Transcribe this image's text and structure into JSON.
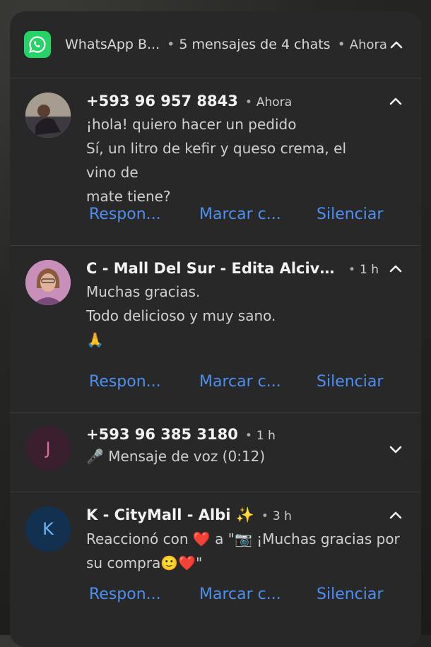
{
  "header": {
    "app_name": "WhatsApp B...",
    "summary": "5 mensajes de 4 chats",
    "time": "Ahora",
    "app_icon": "whatsapp-business-icon"
  },
  "notifications": [
    {
      "sender": "+593 96 957 8843",
      "time": "Ahora",
      "lines": [
        "¡hola! quiero hacer un pedido",
        "Sí, un litro de kefir y queso crema, el vino de",
        "mate tiene?"
      ],
      "expanded": true,
      "avatar": "photo"
    },
    {
      "sender": "C - Mall Del Sur - Edita Alcivar de...",
      "time": "1 h",
      "lines": [
        "Muchas gracias.",
        "Todo delicioso y muy sano.",
        "🙏"
      ],
      "expanded": true,
      "avatar": "photo"
    },
    {
      "sender": "+593 96 385 3180",
      "time": "1 h",
      "lines": [
        "🎤 Mensaje de voz (0:12)"
      ],
      "expanded": false,
      "avatar_letter": "J",
      "avatar_color": "#3a1f2e",
      "avatar_text_color": "#e06a9a"
    },
    {
      "sender": "K - CityMall - Albi ✨",
      "time": "3 h",
      "lines": [
        "Reaccionó con ❤️ a \"📷 ¡Muchas gracias por",
        "su compra🙂❤️\""
      ],
      "expanded": true,
      "avatar_letter": "K",
      "avatar_color": "#123050",
      "avatar_text_color": "#6fb3f0"
    }
  ],
  "actions": {
    "reply": "Respon...",
    "mark_read": "Marcar c...",
    "mute": "Silenciar"
  },
  "colors": {
    "accent": "#4d8ff0",
    "whatsapp_green": "#25d366",
    "panel": "#282828"
  }
}
